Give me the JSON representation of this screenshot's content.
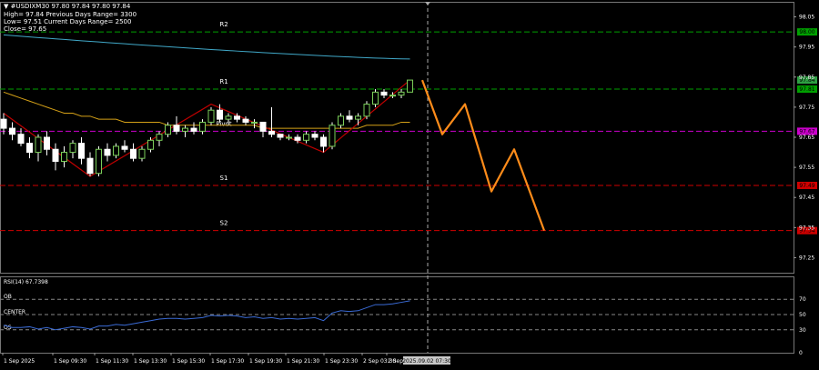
{
  "header": {
    "symbol_line": "#USDIXM30  97.80 97.84 97.80 97.84",
    "high_line": "High= 97.84    Previous Days Range= 3300",
    "low_line": "Low= 97.51    Current Days Range= 2500",
    "close_line": "Close= 97.65"
  },
  "colors": {
    "background": "#000000",
    "up_candle": "#ffffff",
    "down_candle": "#ffffff",
    "fast_ma": "#1e90ff",
    "slow_ma": "#d4a017",
    "zigzag": "#c00000",
    "forecast": "#ff8c1a",
    "pivot_line": "#cc00cc",
    "support_line": "#d00000",
    "resistance_line": "#00a000",
    "rsi_line": "#3a6bd6"
  },
  "chart_data": {
    "type": "candlestick",
    "ylim": [
      97.2,
      98.1
    ],
    "price_ticks": [
      "98.05",
      "97.95",
      "97.85",
      "97.75",
      "97.65",
      "97.55",
      "97.45",
      "97.35",
      "97.25"
    ],
    "levels": [
      {
        "name": "R2",
        "value": 98.0,
        "tag": "98.00",
        "color": "#00a000"
      },
      {
        "name": "R1",
        "value": 97.81,
        "tag": "97.81",
        "color": "#00a000"
      },
      {
        "name": "Pivot",
        "value": 97.67,
        "tag": "97.67",
        "color": "#cc00cc"
      },
      {
        "name": "S1",
        "value": 97.49,
        "tag": "97.49",
        "color": "#d00000"
      },
      {
        "name": "S2",
        "value": 97.34,
        "tag": "97.34",
        "color": "#d00000"
      }
    ],
    "current_price_tag": "97.84",
    "candles": [
      [
        97.71,
        97.73,
        97.66,
        97.68
      ],
      [
        97.68,
        97.7,
        97.64,
        97.66
      ],
      [
        97.66,
        97.68,
        97.62,
        97.63
      ],
      [
        97.63,
        97.65,
        97.58,
        97.6
      ],
      [
        97.6,
        97.66,
        97.57,
        97.65
      ],
      [
        97.65,
        97.67,
        97.59,
        97.61
      ],
      [
        97.61,
        97.63,
        97.54,
        97.57
      ],
      [
        97.57,
        97.62,
        97.55,
        97.6
      ],
      [
        97.6,
        97.64,
        97.58,
        97.63
      ],
      [
        97.63,
        97.65,
        97.56,
        97.58
      ],
      [
        97.58,
        97.6,
        97.52,
        97.53
      ],
      [
        97.53,
        97.62,
        97.52,
        97.61
      ],
      [
        97.61,
        97.63,
        97.57,
        97.59
      ],
      [
        97.59,
        97.63,
        97.58,
        97.62
      ],
      [
        97.62,
        97.64,
        97.6,
        97.61
      ],
      [
        97.61,
        97.63,
        97.57,
        97.58
      ],
      [
        97.58,
        97.62,
        97.57,
        97.61
      ],
      [
        97.61,
        97.65,
        97.6,
        97.64
      ],
      [
        97.64,
        97.67,
        97.62,
        97.66
      ],
      [
        97.66,
        97.7,
        97.65,
        97.69
      ],
      [
        97.69,
        97.72,
        97.66,
        97.67
      ],
      [
        97.67,
        97.69,
        97.65,
        97.68
      ],
      [
        97.68,
        97.7,
        97.66,
        97.67
      ],
      [
        97.67,
        97.71,
        97.66,
        97.7
      ],
      [
        97.7,
        97.75,
        97.69,
        97.74
      ],
      [
        97.74,
        97.76,
        97.7,
        97.71
      ],
      [
        97.71,
        97.73,
        97.69,
        97.72
      ],
      [
        97.72,
        97.73,
        97.7,
        97.71
      ],
      [
        97.71,
        97.72,
        97.69,
        97.7
      ],
      [
        97.7,
        97.71,
        97.68,
        97.7
      ],
      [
        97.7,
        97.7,
        97.65,
        97.67
      ],
      [
        97.67,
        97.75,
        97.65,
        97.66
      ],
      [
        97.66,
        97.66,
        97.64,
        97.65
      ],
      [
        97.65,
        97.66,
        97.64,
        97.65
      ],
      [
        97.65,
        97.66,
        97.63,
        97.64
      ],
      [
        97.64,
        97.67,
        97.63,
        97.66
      ],
      [
        97.66,
        97.67,
        97.64,
        97.65
      ],
      [
        97.65,
        97.66,
        97.6,
        97.62
      ],
      [
        97.62,
        97.7,
        97.61,
        97.69
      ],
      [
        97.69,
        97.73,
        97.68,
        97.72
      ],
      [
        97.72,
        97.74,
        97.7,
        97.71
      ],
      [
        97.71,
        97.73,
        97.69,
        97.72
      ],
      [
        97.72,
        97.77,
        97.71,
        97.76
      ],
      [
        97.76,
        97.81,
        97.75,
        97.8
      ],
      [
        97.8,
        97.81,
        97.78,
        97.79
      ],
      [
        97.79,
        97.8,
        97.78,
        97.79
      ],
      [
        97.79,
        97.81,
        97.78,
        97.8
      ],
      [
        97.8,
        97.84,
        97.8,
        97.84
      ]
    ],
    "slow_ma": [
      97.8,
      97.79,
      97.78,
      97.77,
      97.76,
      97.75,
      97.74,
      97.73,
      97.73,
      97.72,
      97.72,
      97.71,
      97.71,
      97.71,
      97.7,
      97.7,
      97.7,
      97.7,
      97.7,
      97.69,
      97.69,
      97.69,
      97.69,
      97.69,
      97.69,
      97.69,
      97.69,
      97.69,
      97.69,
      97.69,
      97.68,
      97.68,
      97.68,
      97.68,
      97.68,
      97.68,
      97.68,
      97.68,
      97.68,
      97.68,
      97.68,
      97.68,
      97.69,
      97.69,
      97.69,
      97.69,
      97.7,
      97.7
    ],
    "fast_ma_start": 97.99,
    "fast_ma_end": 97.91,
    "zigzag_idx": [
      0,
      10,
      24,
      37,
      47
    ],
    "zigzag_val": [
      97.73,
      97.52,
      97.76,
      97.6,
      97.84
    ],
    "forecast": [
      97.84,
      97.66,
      97.76,
      97.47,
      97.61,
      97.34
    ],
    "time_ticks": [
      "1 Sep 2025",
      "1 Sep 09:30",
      "1 Sep 11:30",
      "1 Sep 13:30",
      "1 Sep 15:30",
      "1 Sep 17:30",
      "1 Sep 19:30",
      "1 Sep 21:30",
      "1 Sep 23:30",
      "2 Sep 03:30",
      "2 Sep"
    ],
    "time_highlight": "2025.09.02 07:30",
    "rsi": {
      "label": "RSI(14) 67.7398",
      "ticks": [
        "70",
        "50",
        "30",
        "0"
      ],
      "level_labels": [
        "OB",
        "CENTER",
        "OS"
      ],
      "values": [
        36,
        33,
        33,
        34,
        31,
        33,
        30,
        32,
        34,
        33,
        31,
        35,
        35,
        37,
        36,
        38,
        40,
        42,
        44,
        45,
        45,
        44,
        45,
        46,
        49,
        48,
        49,
        48,
        46,
        47,
        45,
        46,
        44,
        45,
        44,
        45,
        46,
        42,
        52,
        55,
        54,
        55,
        59,
        63,
        63,
        64,
        66,
        68
      ]
    }
  }
}
